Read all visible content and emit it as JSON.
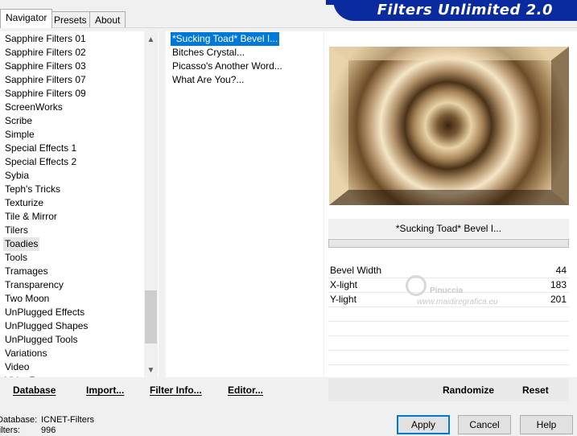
{
  "tabs": [
    "Navigator",
    "Presets",
    "About"
  ],
  "title": "Filters Unlimited 2.0",
  "categories": [
    "Sapphire Filters 01",
    "Sapphire Filters 02",
    "Sapphire Filters 03",
    "Sapphire Filters 07",
    "Sapphire Filters 09",
    "ScreenWorks",
    "Scribe",
    "Simple",
    "Special Effects 1",
    "Special Effects 2",
    "Sybia",
    "Teph's Tricks",
    "Texturize",
    "Tile & Mirror",
    "Tilers",
    "Toadies",
    "Tools",
    "Tramages",
    "Transparency",
    "Two Moon",
    "UnPlugged Effects",
    "UnPlugged Shapes",
    "UnPlugged Tools",
    "Variations",
    "Video",
    "VideoRave"
  ],
  "selected_category": "Toadies",
  "filters": [
    "*Sucking Toad*  Bevel I...",
    "Bitches Crystal...",
    "Picasso's Another Word...",
    "What Are You?..."
  ],
  "selected_filter": "*Sucking Toad*  Bevel I...",
  "filter_name": "*Sucking Toad*  Bevel I...",
  "params": [
    {
      "label": "Bevel Width",
      "value": "44"
    },
    {
      "label": "X-light",
      "value": "183"
    },
    {
      "label": "Y-light",
      "value": "201"
    }
  ],
  "watermark": {
    "name": "Pinuccia",
    "url": "www.maidiregrafica.eu"
  },
  "buttons": {
    "database": "Database",
    "import": "Import...",
    "filter_info": "Filter Info...",
    "editor": "Editor...",
    "randomize": "Randomize",
    "reset": "Reset"
  },
  "footer": {
    "database_label": "Database:",
    "database_value": "ICNET-Filters",
    "filters_label": "Filters:",
    "filters_value": "996"
  },
  "dialog": {
    "apply": "Apply",
    "cancel": "Cancel",
    "help": "Help"
  },
  "colors": {
    "banner": "#0a2aa0",
    "selection": "#0078d7"
  }
}
